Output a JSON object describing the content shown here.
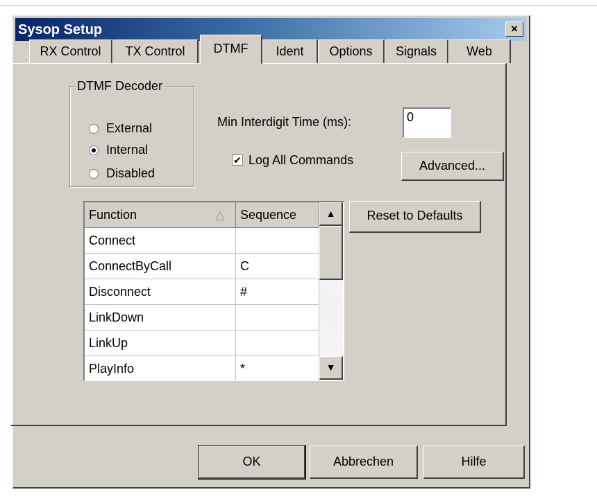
{
  "window": {
    "title": "Sysop Setup",
    "close_glyph": "×"
  },
  "tabs": [
    {
      "label": "RX Control"
    },
    {
      "label": "TX Control"
    },
    {
      "label": "DTMF",
      "active": true
    },
    {
      "label": "Ident"
    },
    {
      "label": "Options"
    },
    {
      "label": "Signals"
    },
    {
      "label": "Web"
    }
  ],
  "decoder": {
    "group_label": "DTMF Decoder",
    "options": [
      "External",
      "Internal",
      "Disabled"
    ],
    "selected": "Internal"
  },
  "interdigit": {
    "label": "Min Interdigit Time (ms):",
    "value": "0"
  },
  "log_all": {
    "label": "Log All Commands",
    "checked": true,
    "check_glyph": "✔"
  },
  "buttons": {
    "advanced": "Advanced...",
    "reset": "Reset to Defaults"
  },
  "table": {
    "headers": [
      "Function",
      "Sequence"
    ],
    "sort_glyph": "△",
    "rows": [
      {
        "function": "Connect",
        "sequence": ""
      },
      {
        "function": "ConnectByCall",
        "sequence": "C"
      },
      {
        "function": "Disconnect",
        "sequence": "#"
      },
      {
        "function": "LinkDown",
        "sequence": ""
      },
      {
        "function": "LinkUp",
        "sequence": ""
      },
      {
        "function": "PlayInfo",
        "sequence": "*"
      }
    ],
    "scroll_up_glyph": "▲",
    "scroll_down_glyph": "▼"
  },
  "footer": {
    "ok": "OK",
    "cancel": "Abbrechen",
    "help": "Hilfe"
  }
}
